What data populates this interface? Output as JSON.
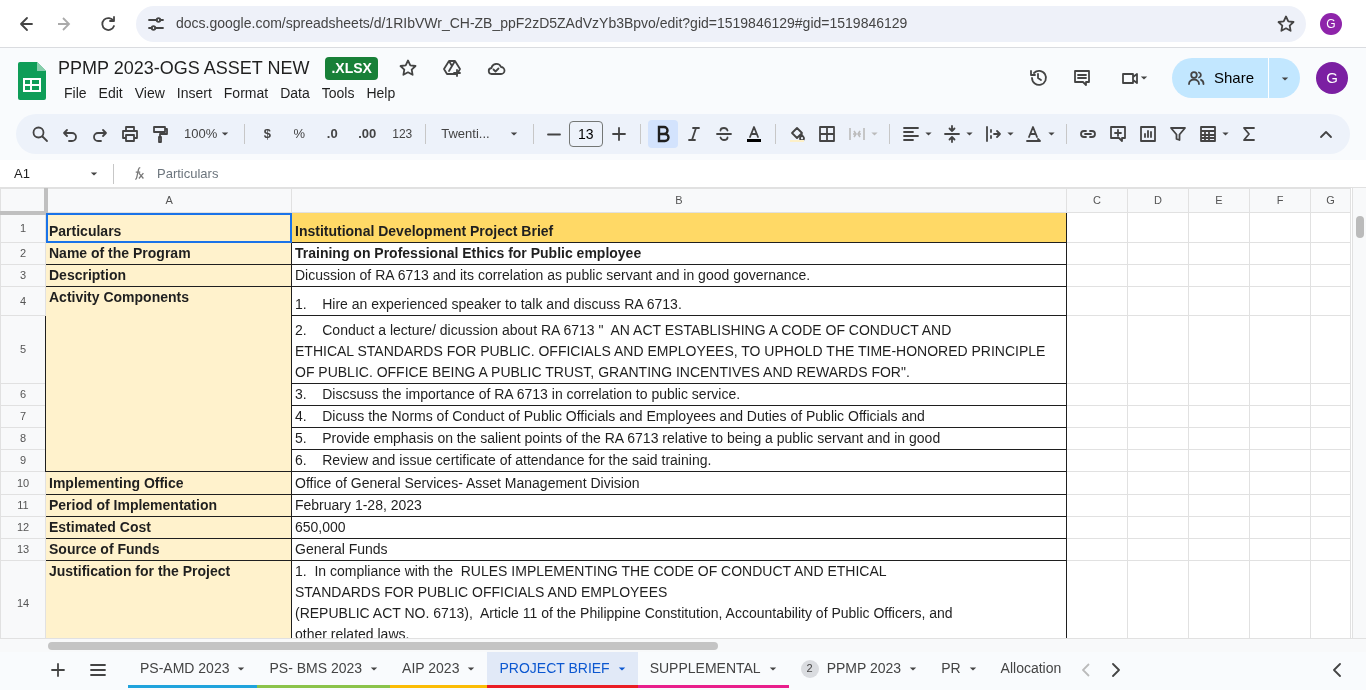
{
  "browser": {
    "url": "docs.google.com/spreadsheets/d/1RIbVWr_CH-ZB_ppF2zD5ZAdVzYb3Bpvo/edit?gid=1519846129#gid=1519846129",
    "profile_letter": "G"
  },
  "document": {
    "title": "PPMP 2023-OGS ASSET NEW",
    "format_badge": ".XLSX",
    "menus": [
      "File",
      "Edit",
      "View",
      "Insert",
      "Format",
      "Data",
      "Tools",
      "Help"
    ]
  },
  "header": {
    "share_label": "Share",
    "avatar_letter": "G"
  },
  "toolbar": {
    "zoom": "100%",
    "currency": "$",
    "percent": "%",
    "decrease_decimals": ".0",
    "increase_decimals": ".00",
    "number_format": "123",
    "font": "Twenti...",
    "font_size": "13",
    "bold": true,
    "italic": false,
    "strikethrough": false
  },
  "formula_bar": {
    "cell_ref": "A1",
    "content": "Particulars"
  },
  "columns": [
    "A",
    "B",
    "C",
    "D",
    "E",
    "F",
    "G"
  ],
  "sections": [
    {
      "label": "Particulars",
      "selected": true,
      "kind": "title",
      "rows": [
        {
          "number": "1",
          "lines": [
            "Institutional Development Project Brief"
          ]
        }
      ]
    },
    {
      "label": "Name of the Program",
      "selected": false,
      "kind": "emphasis",
      "rows": [
        {
          "number": "2",
          "lines": [
            "Training on Professional Ethics for Public employee"
          ]
        }
      ]
    },
    {
      "label": "Description",
      "selected": false,
      "kind": "normal",
      "rows": [
        {
          "number": "3",
          "lines": [
            "Dicussion of RA 6713 and its correlation as public servant and in good governance."
          ]
        }
      ]
    },
    {
      "label": "Activity Components",
      "selected": false,
      "kind": "normal",
      "rows": [
        {
          "number": "4",
          "lines": [
            "1.    Hire an experienced speaker to talk and discuss RA 6713."
          ]
        },
        {
          "number": "5",
          "lines": [
            "2.    Conduct a lecture/ dicussion about RA 6713 \"  AN ACT ESTABLISHING A CODE OF CONDUCT AND",
            "ETHICAL STANDARDS FOR PUBLIC. OFFICIALS AND EMPLOYEES, TO UPHOLD THE TIME-HONORED PRINCIPLE",
            "OF PUBLIC. OFFICE BEING A PUBLIC TRUST, GRANTING INCENTIVES AND REWARDS FOR\"."
          ]
        },
        {
          "number": "6",
          "lines": [
            "3.    Discsuss the importance of RA 6713 in correlation to public service."
          ]
        },
        {
          "number": "7",
          "lines": [
            "4.    Dicuss the Norms of Conduct of Public Officials and Employees and Duties of Public Officials and"
          ]
        },
        {
          "number": "8",
          "lines": [
            "5.    Provide emphasis on the salient points of the RA 6713 relative to being a public servant and in good"
          ]
        },
        {
          "number": "9",
          "lines": [
            "6.    Review and issue certificate of attendance for the said training."
          ]
        }
      ]
    },
    {
      "label": "Implementing Office",
      "selected": false,
      "kind": "normal",
      "rows": [
        {
          "number": "10",
          "lines": [
            "Office of General Services- Asset Management Division"
          ]
        }
      ]
    },
    {
      "label": "Period of Implementation",
      "selected": false,
      "kind": "normal",
      "rows": [
        {
          "number": "11",
          "lines": [
            "February 1-28, 2023"
          ]
        }
      ]
    },
    {
      "label": "Estimated Cost",
      "selected": false,
      "kind": "normal",
      "rows": [
        {
          "number": "12",
          "lines": [
            "650,000"
          ]
        }
      ]
    },
    {
      "label": "Source of Funds",
      "selected": false,
      "kind": "normal",
      "rows": [
        {
          "number": "13",
          "lines": [
            "General Funds"
          ]
        }
      ]
    },
    {
      "label": "Justification for the Project",
      "selected": false,
      "kind": "normal",
      "rows": [
        {
          "number": "14",
          "lines": [
            "1.  In compliance with the  RULES IMPLEMENTING THE CODE OF CONDUCT AND ETHICAL",
            "STANDARDS FOR PUBLIC OFFICIALS AND EMPLOYEES",
            "(REPUBLIC ACT NO. 6713),  Article 11 of the Philippine Constitution, Accountability of Public Officers, and",
            "other related laws."
          ]
        }
      ]
    }
  ],
  "sheet_tabs": [
    {
      "label": "PS-AMD 2023",
      "selected": false,
      "color": "#1fa3dc"
    },
    {
      "label": "PS- BMS 2023",
      "selected": false,
      "color": "#8bc34a"
    },
    {
      "label": "AIP 2023",
      "selected": false,
      "color": "#fbbc04"
    },
    {
      "label": "PROJECT BRIEF",
      "selected": true,
      "color": "#ea1c24"
    },
    {
      "label": "SUPPLEMENTAL",
      "selected": false,
      "color": "#e91e8c"
    },
    {
      "label": "PPMP 2023",
      "selected": false,
      "badge": "2"
    },
    {
      "label": "PR",
      "selected": false
    },
    {
      "label": "Allocation",
      "selected": false
    }
  ]
}
